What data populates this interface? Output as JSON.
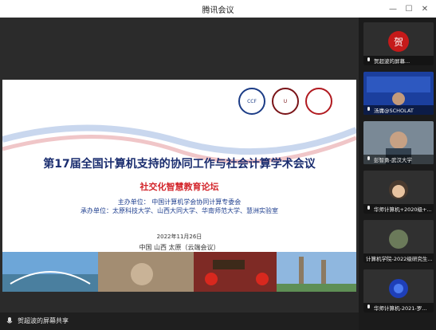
{
  "window": {
    "title": "腾讯会议"
  },
  "slide": {
    "logos": [
      "CCF",
      "U",
      ""
    ],
    "title": "第17届全国计算机支持的协同工作与社会计算学术会议",
    "subtitle": "社交化智慧教育论坛",
    "host_line": "主办单位：  中国计算机学会协同计算专委会",
    "co_host_line": "承办单位：太原科技大学、山西大同大学、华南师范大学、慧洲实验室",
    "date": "2022年11月26日",
    "place": "中国 山西 太原（云端会议）"
  },
  "share_bar": {
    "label": "贺超波的屏幕共享"
  },
  "participants": [
    {
      "name": "贺超波的屏幕..."
    },
    {
      "name": "汤庸@SCHOLAT"
    },
    {
      "name": "彭智勇-武汉大学"
    },
    {
      "name": "华师计算机+2020级+..."
    },
    {
      "name": "计算机学院-2022级研究生..."
    },
    {
      "name": "华师计算机-2021-罗..."
    }
  ],
  "colors": {
    "accent_blue": "#1a2d6f",
    "accent_red": "#d3252b"
  }
}
